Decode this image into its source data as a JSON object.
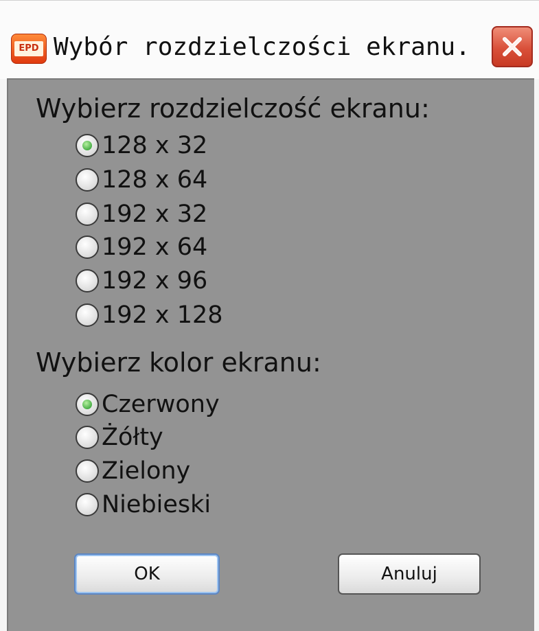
{
  "window": {
    "title": "Wybór rozdzielczości ekranu.",
    "app_icon_text": "EPD",
    "close_icon": "close-x-icon"
  },
  "resolution": {
    "label": "Wybierz rozdzielczość ekranu:",
    "options": [
      {
        "label": "128 x 32",
        "checked": true
      },
      {
        "label": "128 x 64",
        "checked": false
      },
      {
        "label": "192 x 32",
        "checked": false
      },
      {
        "label": "192 x 64",
        "checked": false
      },
      {
        "label": "192 x 96",
        "checked": false
      },
      {
        "label": "192 x 128",
        "checked": false
      }
    ]
  },
  "color": {
    "label": "Wybierz kolor ekranu:",
    "options": [
      {
        "label": "Czerwony",
        "checked": true
      },
      {
        "label": "Żółty",
        "checked": false
      },
      {
        "label": "Zielony",
        "checked": false
      },
      {
        "label": "Niebieski",
        "checked": false
      }
    ]
  },
  "buttons": {
    "ok_label": "OK",
    "cancel_label": "Anuluj"
  },
  "colors": {
    "client_background": "#939393",
    "radio_checked": "#3aa53a",
    "close_button": "#d9503a"
  }
}
